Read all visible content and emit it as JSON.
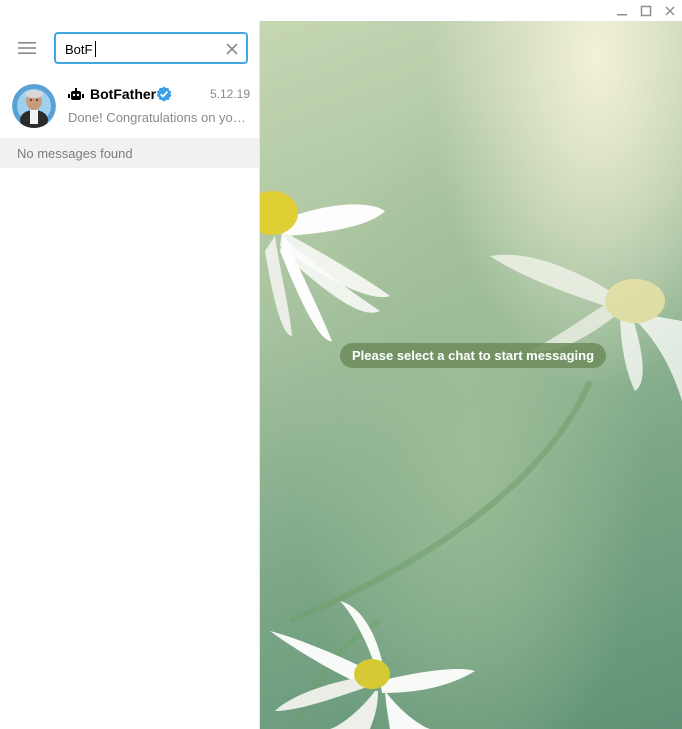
{
  "window": {
    "minimize_icon": "minimize-icon",
    "maximize_icon": "maximize-icon",
    "close_icon": "close-icon"
  },
  "sidebar": {
    "menu_icon": "hamburger-menu-icon",
    "search": {
      "value": "BotF",
      "clear_icon": "close-icon"
    },
    "results": [
      {
        "name": "BotFather",
        "date": "5.12.19",
        "preview": "Done! Congratulations on your new bot.",
        "bot_badge": "bot-icon",
        "verified_badge": "verified-icon"
      }
    ],
    "no_messages_text": "No messages found"
  },
  "main": {
    "empty_state_text": "Please select a chat to start messaging"
  },
  "colors": {
    "accent": "#40a7e3",
    "verified": "#3d9ee8",
    "secondary_text": "#8a8a8a",
    "empty_pill": "#6c8c5c"
  }
}
